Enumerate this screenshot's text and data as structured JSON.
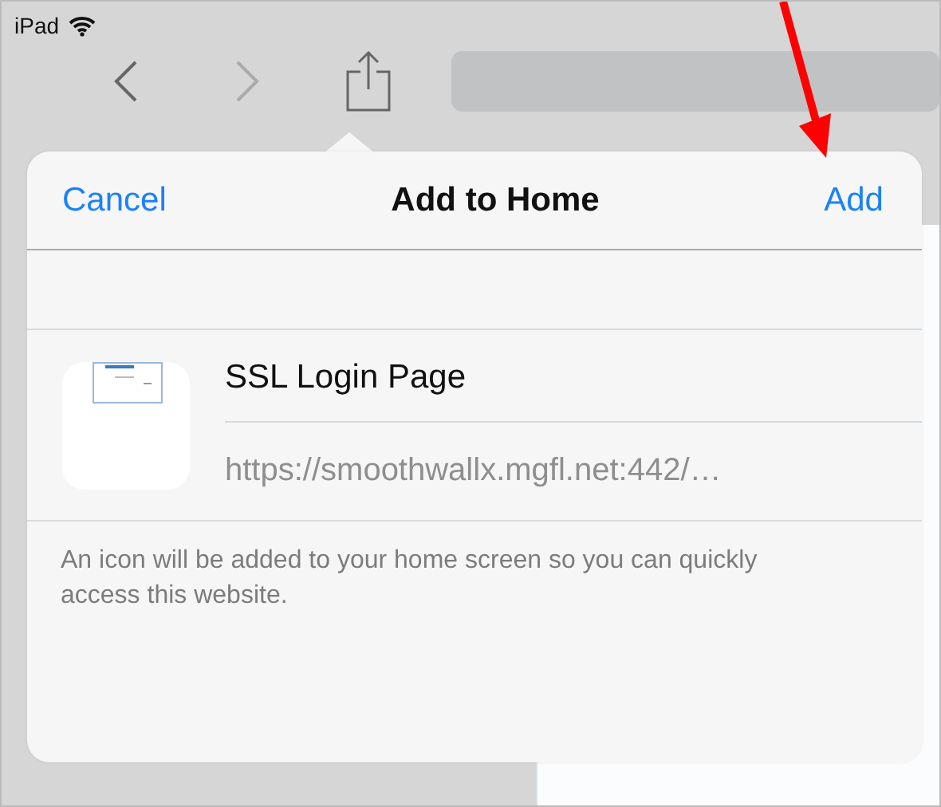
{
  "status_bar": {
    "device": "iPad"
  },
  "sheet": {
    "cancel": "Cancel",
    "title": "Add to Home",
    "add": "Add"
  },
  "bookmark": {
    "title": "SSL Login Page",
    "url": "https://smoothwallx.mgfl.net:442/…"
  },
  "description": "An icon will be added to your home screen so you can quickly access this website."
}
